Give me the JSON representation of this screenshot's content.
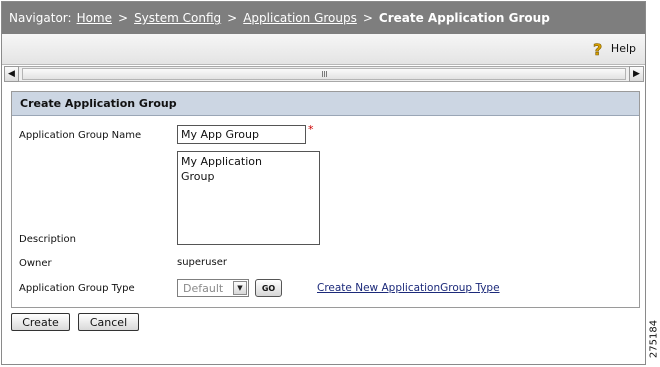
{
  "navigator": {
    "prefix": "Navigator:",
    "crumbs": [
      "Home",
      "System Config",
      "Application Groups"
    ],
    "separator": ">",
    "current": "Create Application Group"
  },
  "toolbar": {
    "help_label": "Help",
    "help_icon": "question-mark-icon"
  },
  "panel": {
    "title": "Create Application Group",
    "labels": {
      "name": "Application Group Name",
      "description": "Description",
      "owner": "Owner",
      "type": "Application Group Type"
    },
    "name_value": "My App Group",
    "required_marker": "*",
    "description_value": "My Application\nGroup",
    "owner_value": "superuser",
    "type_selected": "Default",
    "go_label": "GO",
    "create_type_link": "Create New ApplicationGroup Type"
  },
  "buttons": {
    "create": "Create",
    "cancel": "Cancel"
  },
  "figure_id": "275184",
  "colors": {
    "nav_bg": "#7e7e7e",
    "panel_header_bg": "#ccd6e3",
    "link": "#1c2a7a",
    "required": "#cc0000"
  }
}
